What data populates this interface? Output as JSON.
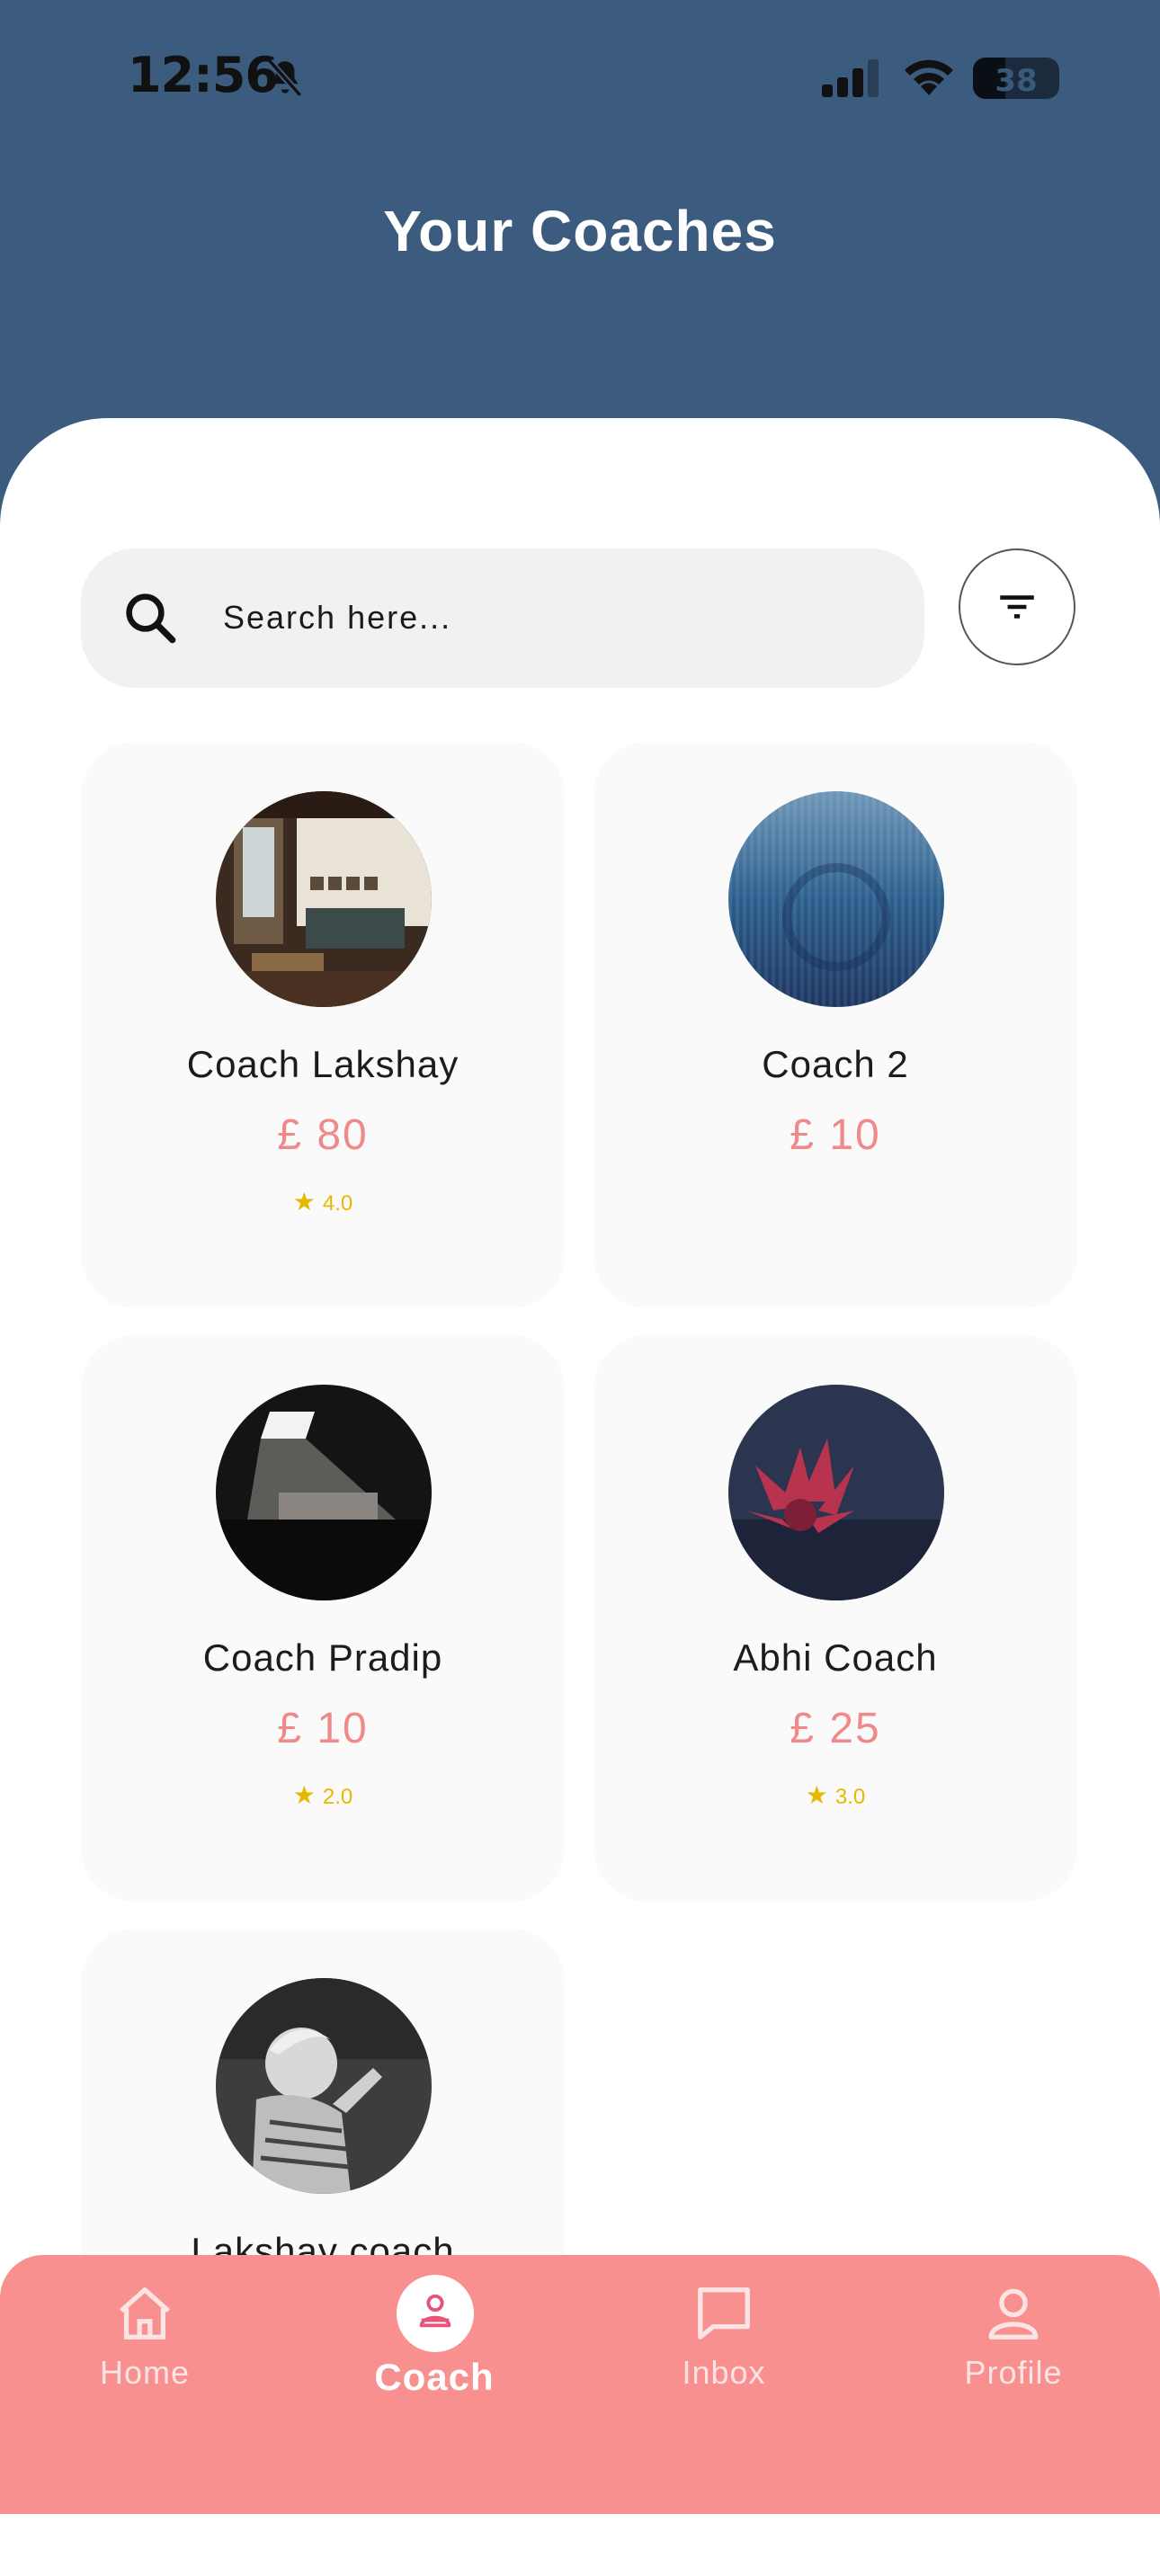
{
  "status_bar": {
    "time": "12:56",
    "battery": "38",
    "battery_level": 0.38
  },
  "header": {
    "title": "Your Coaches"
  },
  "search": {
    "placeholder": "Search here..."
  },
  "coaches": [
    {
      "name": "Coach Lakshay",
      "price": "£ 80",
      "rating": "4.0"
    },
    {
      "name": "Coach 2",
      "price": "£ 10",
      "rating": ""
    },
    {
      "name": "Coach Pradip",
      "price": "£ 10",
      "rating": "2.0"
    },
    {
      "name": "Abhi Coach",
      "price": "£ 25",
      "rating": "3.0"
    },
    {
      "name": "Lakshay coach",
      "price": "",
      "rating": ""
    }
  ],
  "nav": {
    "items": [
      {
        "label": "Home",
        "icon": "home-icon"
      },
      {
        "label": "Coach",
        "icon": "coach-icon"
      },
      {
        "label": "Inbox",
        "icon": "inbox-icon"
      },
      {
        "label": "Profile",
        "icon": "profile-icon"
      }
    ],
    "active": "Coach"
  },
  "colors": {
    "header": "#3b5c7e",
    "accent": "#f99090",
    "price": "#f08a8a",
    "rating": "#e6b800"
  }
}
